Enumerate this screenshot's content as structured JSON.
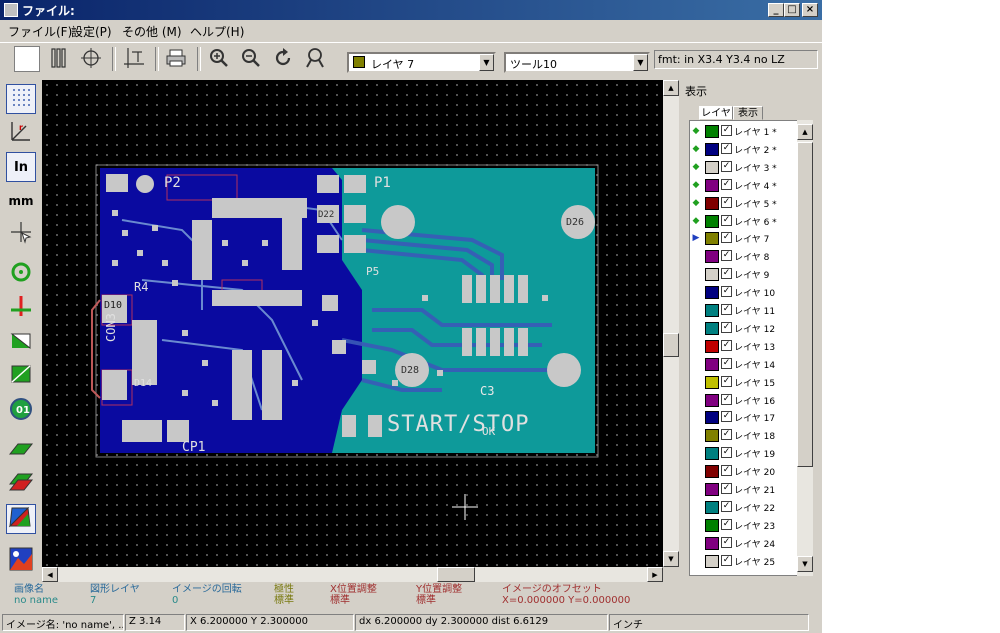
{
  "window": {
    "title": "ファイル:"
  },
  "menu": [
    "ファイル(F)",
    "設定(P)",
    "その他 (M)",
    "ヘルプ(H)"
  ],
  "toolbar": {
    "layer_combo": "レイヤ 7",
    "layer_color": "#808000",
    "tool_combo": "ツール10",
    "fmt_status": "fmt: in X3.4 Y3.4 no LZ"
  },
  "canvas": {
    "silkscreen": {
      "start_stop": "START/STOP",
      "p1": "P1",
      "p2": "P2",
      "c3": "C3",
      "cp1": "CP1",
      "con3": "CON3",
      "d10": "D10",
      "d14": "D14",
      "d22": "D22",
      "d26": "D26",
      "d28": "D28",
      "r4": "R4",
      "p5": "P5",
      "ok": "OK"
    },
    "colors": {
      "background": "#000000",
      "board": "#0e9a9a",
      "top_copper": "#0a0aa0",
      "silk": "#d8d8d8",
      "pad": "#c8c8c8",
      "outline": "#c05a5a"
    }
  },
  "right_panel": {
    "title": "表示",
    "tabs": [
      "レイヤ",
      "表示"
    ],
    "layers": [
      {
        "name": "レイヤ 1 *",
        "color": "#008000",
        "checked": true,
        "marker": "green"
      },
      {
        "name": "レイヤ 2 *",
        "color": "#000080",
        "checked": true,
        "marker": "green"
      },
      {
        "name": "レイヤ 3 *",
        "color": "#d4d0c8",
        "checked": true,
        "marker": "green"
      },
      {
        "name": "レイヤ 4 *",
        "color": "#800080",
        "checked": true,
        "marker": "green"
      },
      {
        "name": "レイヤ 5 *",
        "color": "#800000",
        "checked": true,
        "marker": "green"
      },
      {
        "name": "レイヤ 6 *",
        "color": "#008000",
        "checked": true,
        "marker": "green"
      },
      {
        "name": "レイヤ 7",
        "color": "#808000",
        "checked": true,
        "marker": "blue"
      },
      {
        "name": "レイヤ 8",
        "color": "#800080",
        "checked": true,
        "marker": ""
      },
      {
        "name": "レイヤ 9",
        "color": "#d4d0c8",
        "checked": true,
        "marker": ""
      },
      {
        "name": "レイヤ 10",
        "color": "#000080",
        "checked": true,
        "marker": ""
      },
      {
        "name": "レイヤ 11",
        "color": "#008080",
        "checked": true,
        "marker": ""
      },
      {
        "name": "レイヤ 12",
        "color": "#008080",
        "checked": true,
        "marker": ""
      },
      {
        "name": "レイヤ 13",
        "color": "#c00000",
        "checked": true,
        "marker": ""
      },
      {
        "name": "レイヤ 14",
        "color": "#800080",
        "checked": true,
        "marker": ""
      },
      {
        "name": "レイヤ 15",
        "color": "#c0c000",
        "checked": true,
        "marker": ""
      },
      {
        "name": "レイヤ 16",
        "color": "#800080",
        "checked": true,
        "marker": ""
      },
      {
        "name": "レイヤ 17",
        "color": "#000080",
        "checked": true,
        "marker": ""
      },
      {
        "name": "レイヤ 18",
        "color": "#808000",
        "checked": true,
        "marker": ""
      },
      {
        "name": "レイヤ 19",
        "color": "#008080",
        "checked": true,
        "marker": ""
      },
      {
        "name": "レイヤ 20",
        "color": "#800000",
        "checked": true,
        "marker": ""
      },
      {
        "name": "レイヤ 21",
        "color": "#800080",
        "checked": true,
        "marker": ""
      },
      {
        "name": "レイヤ 22",
        "color": "#008080",
        "checked": true,
        "marker": ""
      },
      {
        "name": "レイヤ 23",
        "color": "#008000",
        "checked": true,
        "marker": ""
      },
      {
        "name": "レイヤ 24",
        "color": "#800080",
        "checked": true,
        "marker": ""
      },
      {
        "name": "レイヤ 25",
        "color": "#d4d0c8",
        "checked": true,
        "marker": ""
      }
    ]
  },
  "infobar": [
    {
      "label": "画像名",
      "value": "no name"
    },
    {
      "label": "図形レイヤ",
      "value": "7"
    },
    {
      "label": "イメージの回転",
      "value": "0"
    },
    {
      "label": "極性",
      "value": "標準"
    },
    {
      "label": "X位置調整",
      "value": "標準"
    },
    {
      "label": "Y位置調整",
      "value": "標準"
    },
    {
      "label": "イメージのオフセット",
      "value": "X=0.000000 Y=0.000000"
    }
  ],
  "status": {
    "image_name": "イメージ名: 'no name', ...",
    "zoom": "Z 3.14",
    "xy": "X 6.200000  Y 2.300000",
    "delta": "dx 6.200000  dy 2.300000  dist 6.6129",
    "units": "インチ"
  }
}
